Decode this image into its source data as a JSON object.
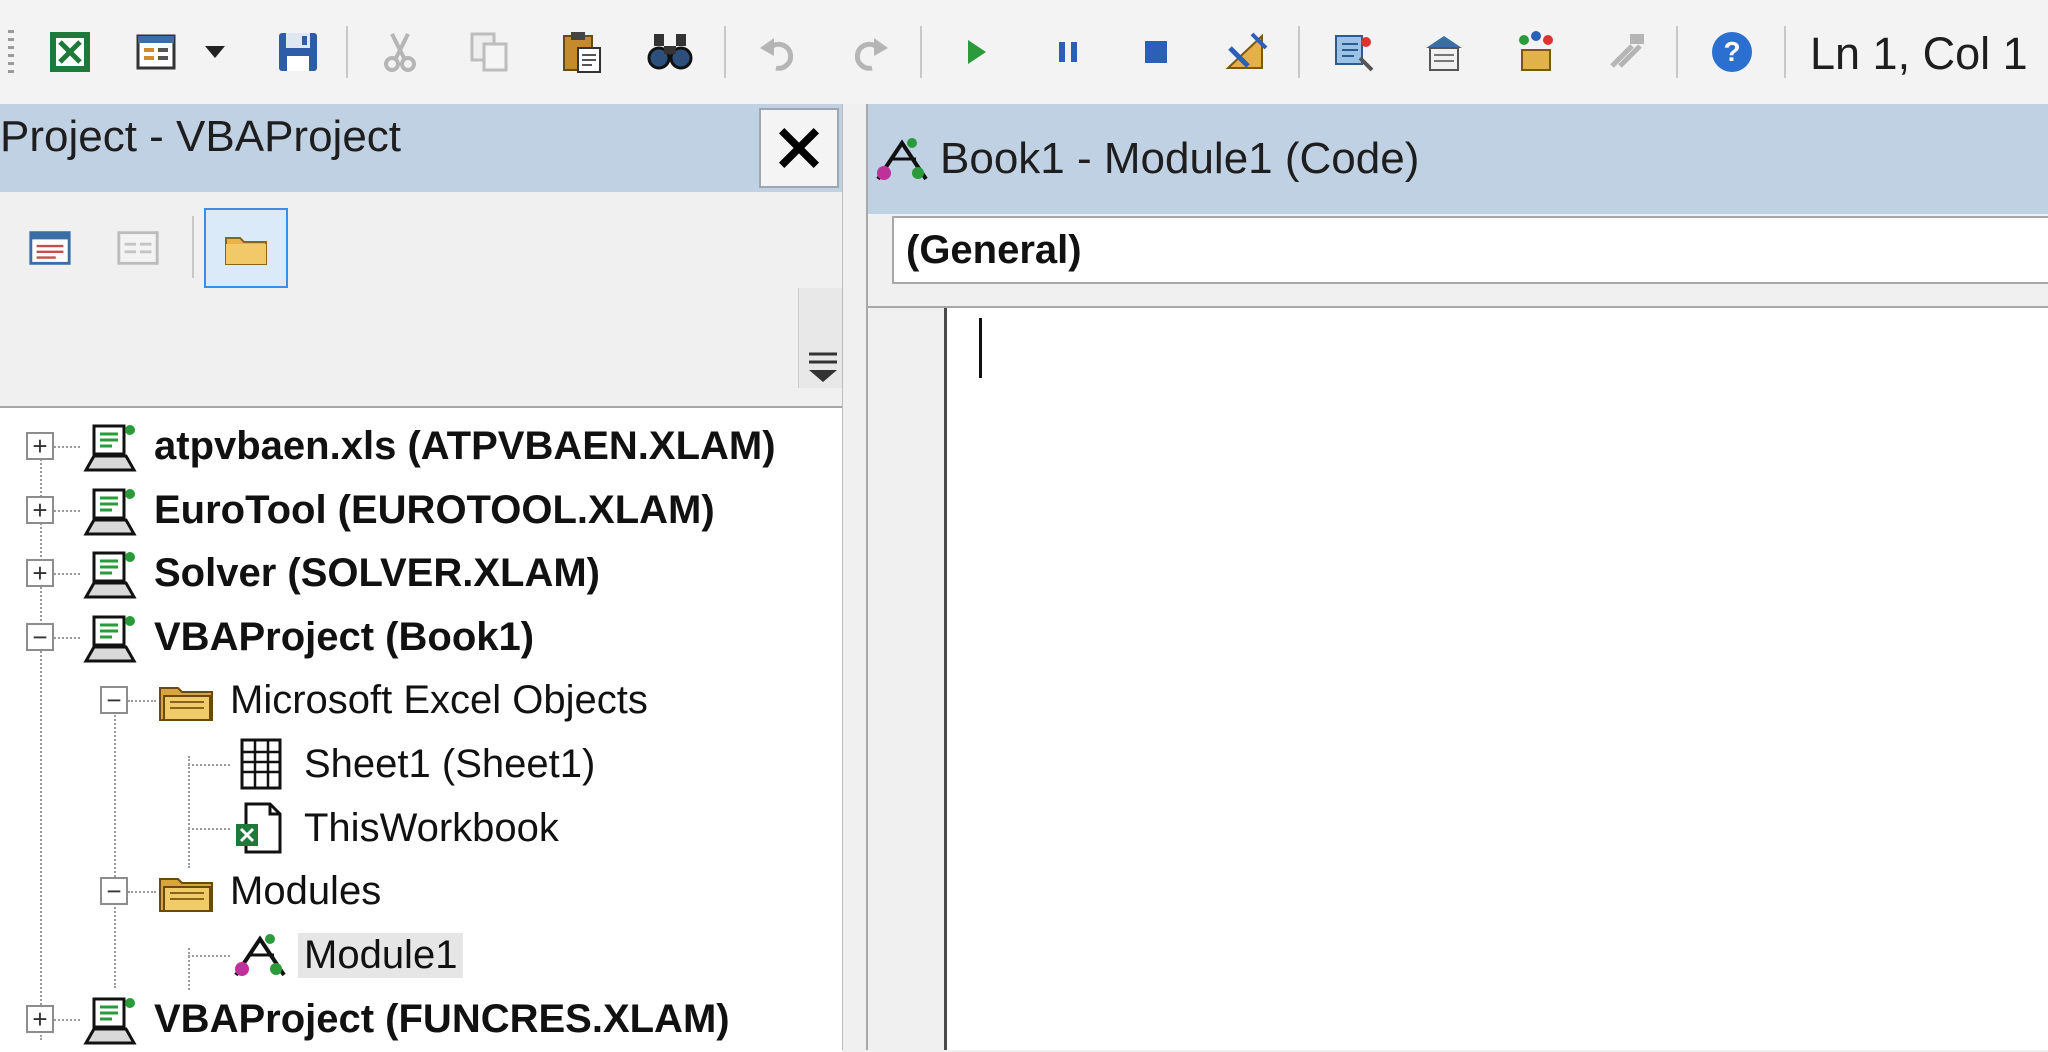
{
  "toolbar": {
    "buttons": [
      {
        "name": "view-excel-icon"
      },
      {
        "name": "insert-userform-icon"
      },
      {
        "name": "dropdown-arrow-icon"
      },
      {
        "name": "save-icon"
      },
      {
        "name": "cut-icon"
      },
      {
        "name": "copy-icon"
      },
      {
        "name": "paste-icon"
      },
      {
        "name": "find-icon"
      },
      {
        "name": "undo-icon"
      },
      {
        "name": "redo-icon"
      },
      {
        "name": "run-icon"
      },
      {
        "name": "break-icon"
      },
      {
        "name": "reset-icon"
      },
      {
        "name": "design-mode-icon"
      },
      {
        "name": "project-explorer-icon"
      },
      {
        "name": "properties-window-icon"
      },
      {
        "name": "object-browser-icon"
      },
      {
        "name": "toolbox-icon"
      },
      {
        "name": "help-icon"
      }
    ],
    "position_readout": "Ln 1, Col 1"
  },
  "explorer": {
    "title": "Project - VBAProject",
    "close_glyph": "✕",
    "buttons": [
      "view-code-icon",
      "view-object-icon",
      "toggle-folders-icon"
    ]
  },
  "tree": {
    "nodes": [
      {
        "label": "atpvbaen.xls (ATPVBAEN.XLAM)",
        "type": "project",
        "expander": "+",
        "bold": true
      },
      {
        "label": "EuroTool (EUROTOOL.XLAM)",
        "type": "project",
        "expander": "+",
        "bold": true
      },
      {
        "label": "Solver (SOLVER.XLAM)",
        "type": "project",
        "expander": "+",
        "bold": true
      },
      {
        "label": "VBAProject (Book1)",
        "type": "project",
        "expander": "−",
        "bold": true
      },
      {
        "label": "Microsoft Excel Objects",
        "type": "folder",
        "expander": "−",
        "bold": false
      },
      {
        "label": "Sheet1 (Sheet1)",
        "type": "sheet",
        "bold": false
      },
      {
        "label": "ThisWorkbook",
        "type": "workbook",
        "bold": false
      },
      {
        "label": "Modules",
        "type": "folder",
        "expander": "−",
        "bold": false
      },
      {
        "label": "Module1",
        "type": "module",
        "bold": false,
        "selected": true
      },
      {
        "label": "VBAProject (FUNCRES.XLAM)",
        "type": "project",
        "expander": "+",
        "bold": true
      }
    ]
  },
  "code_window": {
    "title": "Book1 - Module1 (Code)",
    "object_dropdown": "(General)"
  },
  "colors": {
    "title_bar": "#bfd1e3",
    "selection": "#e6e6e6",
    "pressed_button": "#3a8ee6"
  }
}
